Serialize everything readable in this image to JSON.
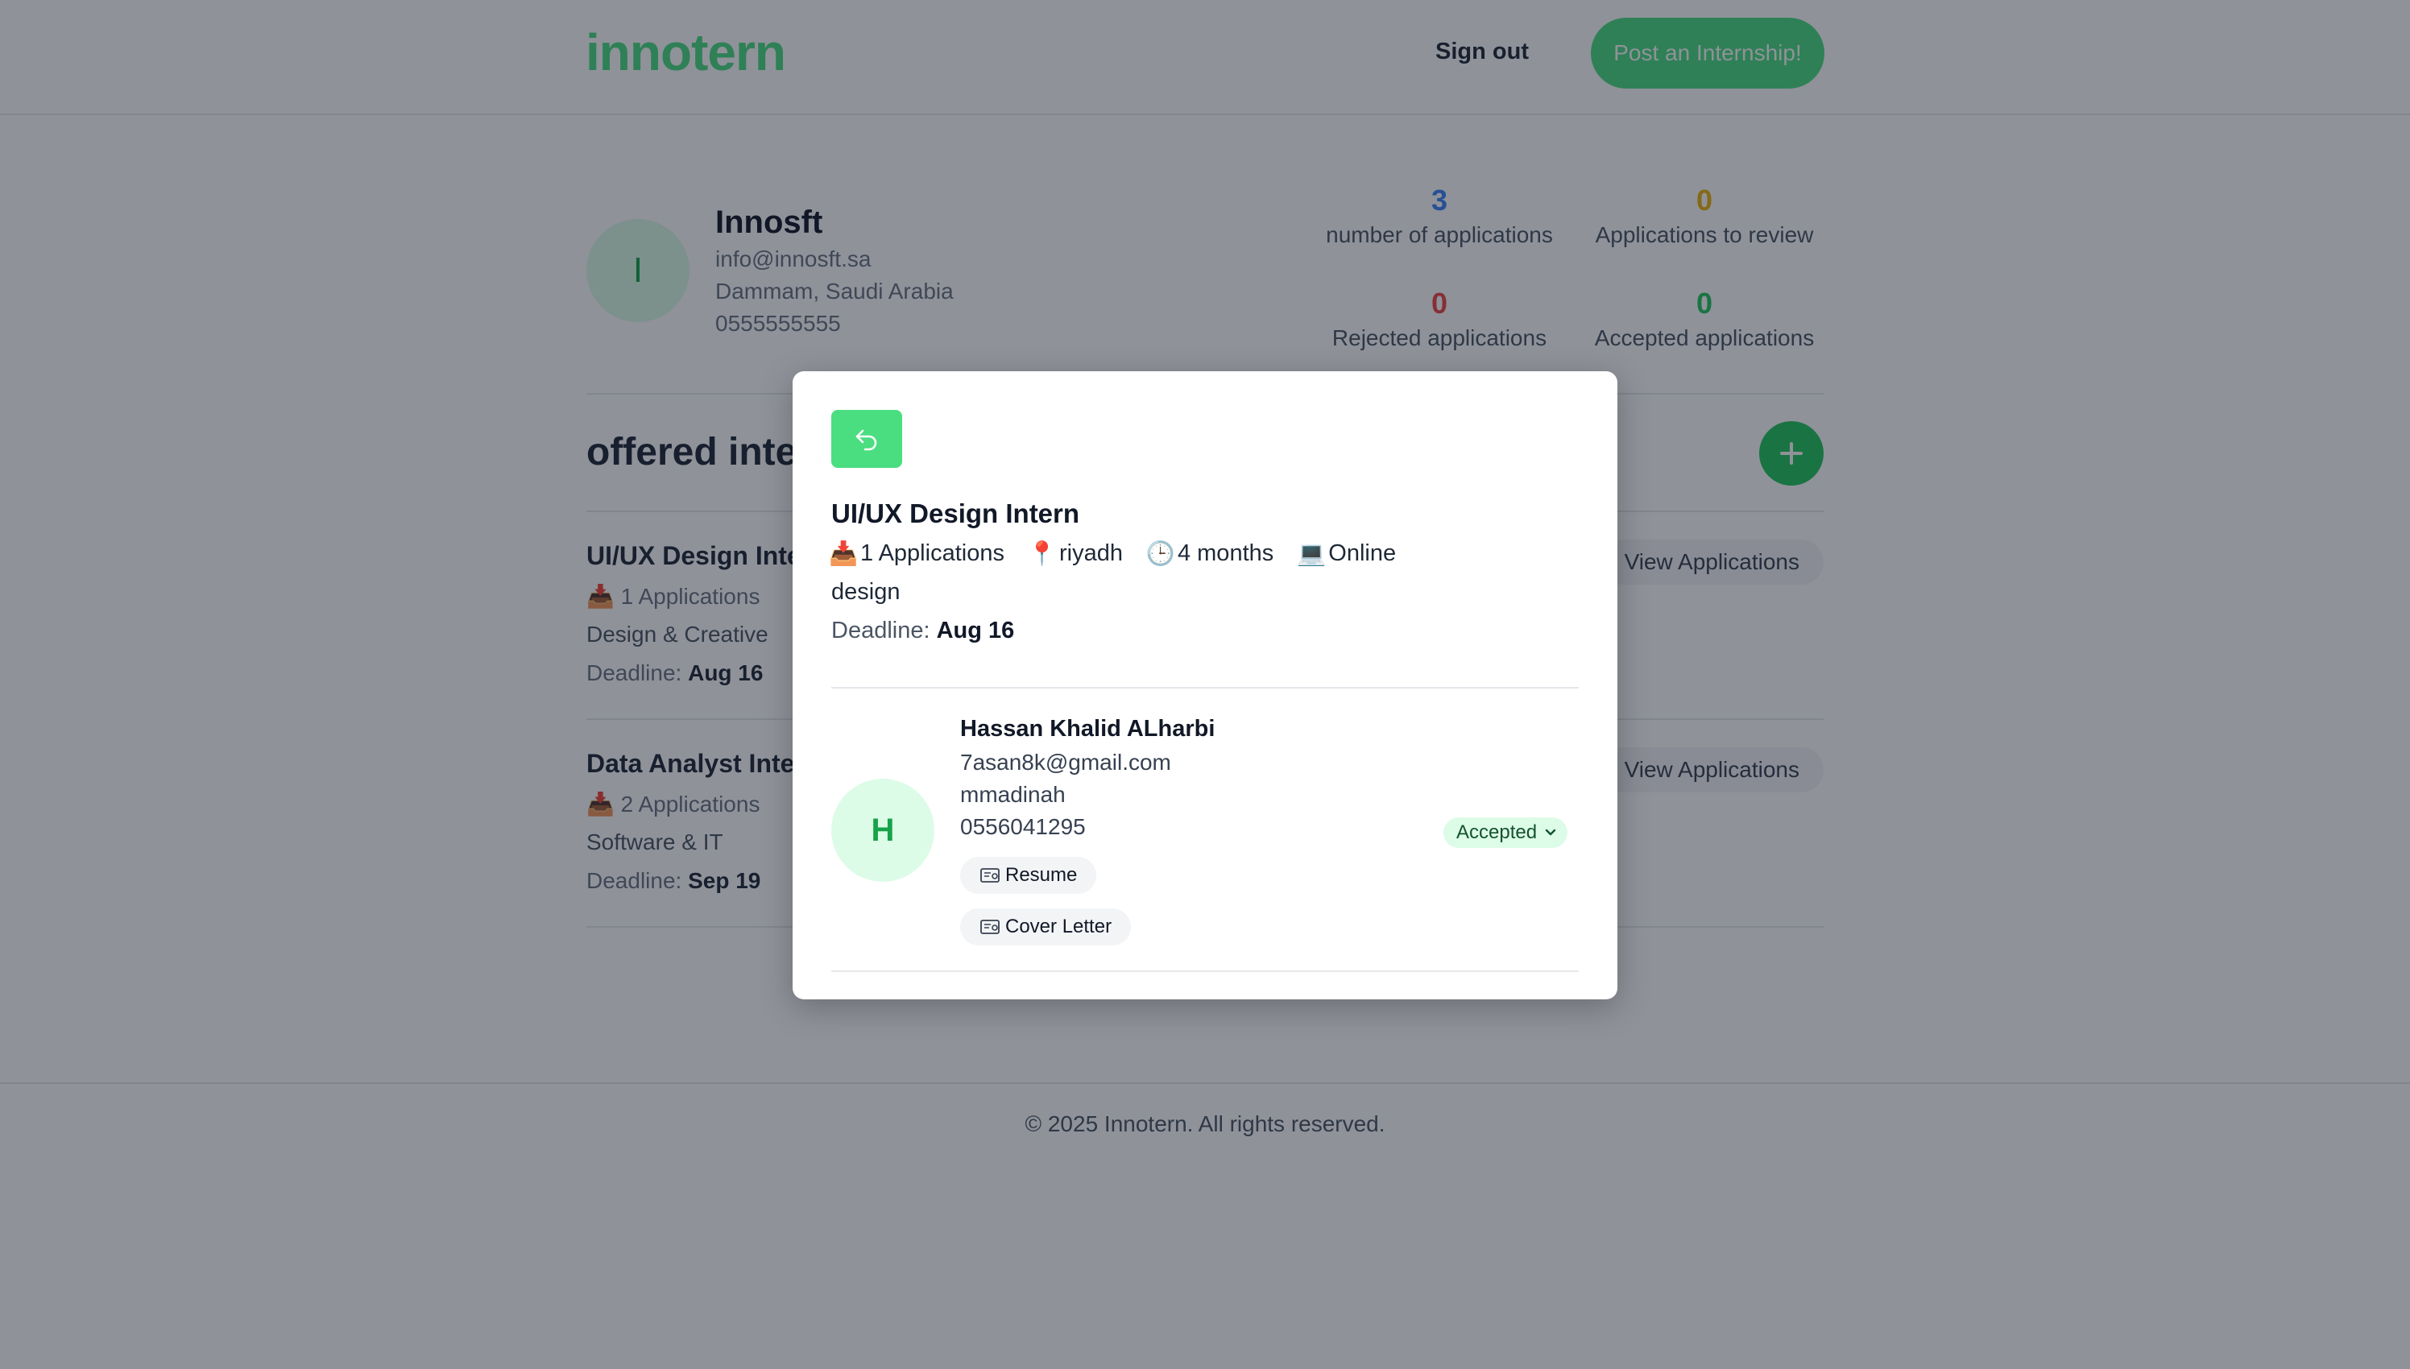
{
  "header": {
    "logo": "innotern",
    "signout_label": "Sign out",
    "post_label": "Post an Internship!"
  },
  "profile": {
    "initial": "I",
    "name": "Innosft",
    "email": "info@innosft.sa",
    "location": "Dammam, Saudi Arabia",
    "phone": "0555555555"
  },
  "stats": [
    {
      "value": "3",
      "label": "number of applications",
      "color": "#3b82f6"
    },
    {
      "value": "0",
      "label": "Applications to review",
      "color": "#eab308"
    },
    {
      "value": "0",
      "label": "Rejected applications",
      "color": "#ef4444"
    },
    {
      "value": "0",
      "label": "Accepted applications",
      "color": "#22c55e"
    }
  ],
  "section": {
    "title": "offered internships",
    "add_icon": "plus-icon"
  },
  "internships": [
    {
      "title": "UI/UX Design Intern",
      "applications": "1 Applications",
      "category": "Design & Creative",
      "deadline_label": "Deadline:",
      "deadline": "Aug 16",
      "view_label": "View Applications"
    },
    {
      "title": "Data Analyst Intern",
      "applications": "2 Applications",
      "category": "Software & IT",
      "deadline_label": "Deadline:",
      "deadline": "Sep 19",
      "view_label": "View Applications"
    }
  ],
  "footer": {
    "text": "© 2025 Innotern. All rights reserved."
  },
  "modal": {
    "back_icon": "back-arrow-icon",
    "title": "UI/UX Design Intern",
    "applications": "1 Applications",
    "location": "riyadh",
    "duration": "4 months",
    "mode": "Online",
    "category": "design",
    "deadline_label": "Deadline:",
    "deadline": "Aug 16",
    "applicant": {
      "initial": "H",
      "name": "Hassan Khalid ALharbi",
      "email": "7asan8k@gmail.com",
      "city": "mmadinah",
      "phone": "0556041295",
      "resume_label": "Resume",
      "cover_label": "Cover Letter",
      "status": "Accepted"
    }
  },
  "colors": {
    "brand": "#4ade80",
    "accepted_bg": "#dcfce7",
    "accepted_text": "#14532d"
  }
}
